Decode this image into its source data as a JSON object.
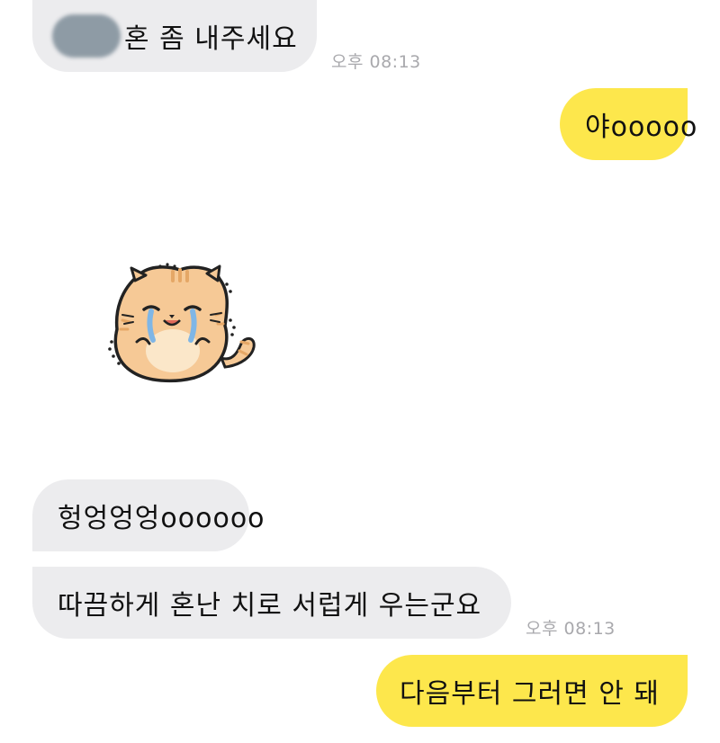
{
  "conversation": {
    "messages": [
      {
        "id": "m1",
        "side": "received",
        "text": "혼 좀 내주세요",
        "has_redacted_name": true
      },
      {
        "id": "m1_time",
        "text": "오후 08:13"
      },
      {
        "id": "m2",
        "side": "sent",
        "text": "야ooooo"
      },
      {
        "id": "m3",
        "side": "sent",
        "type": "sticker",
        "sticker_icon": "crying-cat-sticker-icon"
      },
      {
        "id": "m4",
        "side": "received",
        "text": "헝엉엉엉oooooo"
      },
      {
        "id": "m5",
        "side": "received",
        "text": "따끔하게 혼난 치로 서럽게 우는군요"
      },
      {
        "id": "m5_time",
        "text": "오후 08:13"
      },
      {
        "id": "m6",
        "side": "sent",
        "text": "다음부터 그러면 안 돼"
      }
    ]
  },
  "colors": {
    "received_bubble": "#ececee",
    "sent_bubble": "#fde74c",
    "timestamp": "#a9a9ad",
    "background": "#ffffff",
    "sticker_fur": "#f6c996",
    "sticker_belly": "#fbe7c9",
    "sticker_tears": "#7fb6e6"
  }
}
